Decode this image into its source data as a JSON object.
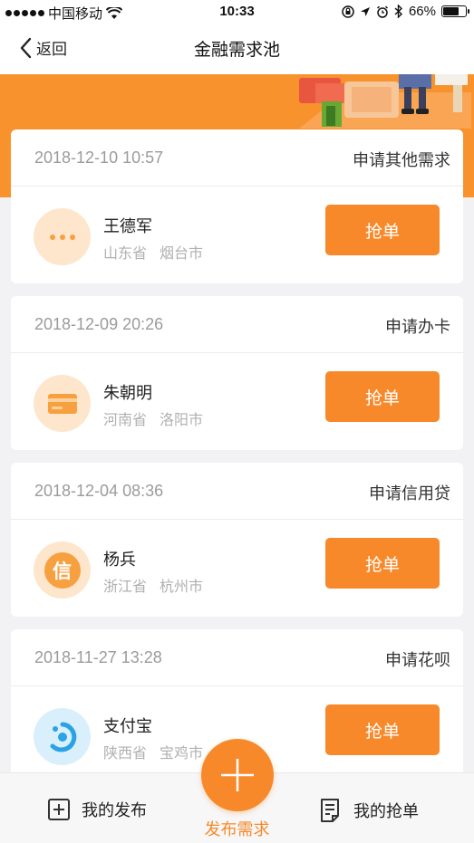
{
  "status_bar": {
    "carrier": "中国移动",
    "time": "10:33",
    "battery_text": "66%",
    "battery_level": 0.66
  },
  "nav": {
    "back_label": "返回",
    "title": "金融需求池"
  },
  "colors": {
    "accent": "#f7892a",
    "banner": "#f7922c"
  },
  "cards": [
    {
      "date": "2018-12-10 10:57",
      "type": "申请其他需求",
      "name": "王德军",
      "province": "山东省",
      "city": "烟台市",
      "icon": "more-dots-icon",
      "button": "抢单"
    },
    {
      "date": "2018-12-09 20:26",
      "type": "申请办卡",
      "name": "朱朝明",
      "province": "河南省",
      "city": "洛阳市",
      "icon": "bank-card-icon",
      "button": "抢单"
    },
    {
      "date": "2018-12-04 08:36",
      "type": "申请信用贷",
      "name": "杨兵",
      "province": "浙江省",
      "city": "杭州市",
      "icon": "credit-xin-icon",
      "icon_text": "信",
      "button": "抢单"
    },
    {
      "date": "2018-11-27 13:28",
      "type": "申请花呗",
      "name": "支付宝",
      "province": "陕西省",
      "city": "宝鸡市",
      "icon": "huabei-icon",
      "button": "抢单"
    }
  ],
  "bottom_bar": {
    "my_posts": "我的发布",
    "publish": "发布需求",
    "my_orders": "我的抢单"
  }
}
